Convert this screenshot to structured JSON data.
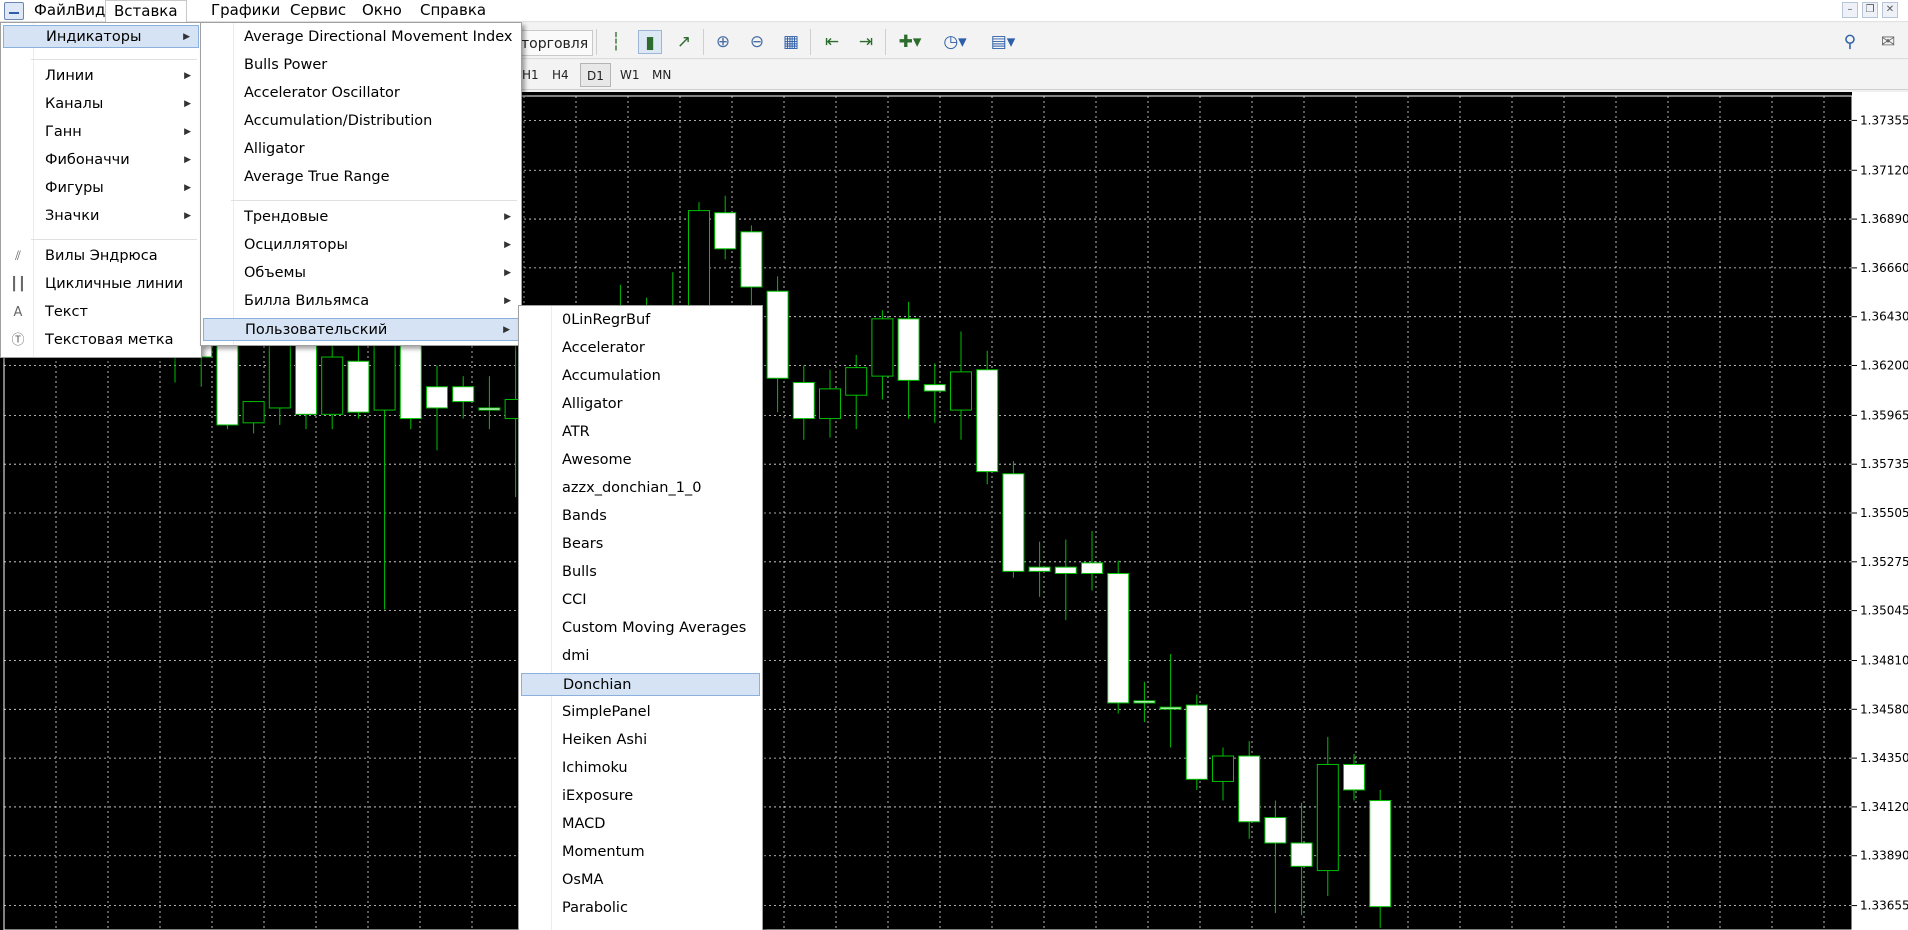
{
  "menubar": {
    "items": [
      "Файл",
      "Вид",
      "Вставка",
      "Графики",
      "Сервис",
      "Окно",
      "Справка"
    ],
    "active_index": 2
  },
  "window_controls": [
    "minimize-icon",
    "restore-icon",
    "close-icon"
  ],
  "toolbar": {
    "trade_label": "торговля",
    "icons": [
      "bar-chart-icon",
      "candlestick-icon",
      "line-chart-icon",
      "zoom-in-icon",
      "zoom-out-icon",
      "tile-windows-icon",
      "auto-scroll-icon",
      "chart-shift-icon",
      "indicators-icon",
      "periods-icon",
      "templates-icon",
      "search-icon",
      "chat-icon"
    ]
  },
  "timeframes": {
    "items": [
      "H1",
      "H4",
      "D1",
      "W1",
      "MN"
    ],
    "selected": "D1"
  },
  "insert_menu": {
    "items": [
      {
        "label": "Индикаторы",
        "submenu": true,
        "highlighted": true
      },
      {
        "separator": true
      },
      {
        "label": "Линии",
        "submenu": true
      },
      {
        "label": "Каналы",
        "submenu": true
      },
      {
        "label": "Ганн",
        "submenu": true
      },
      {
        "label": "Фибоначчи",
        "submenu": true
      },
      {
        "label": "Фигуры",
        "submenu": true
      },
      {
        "label": "Значки",
        "submenu": true
      },
      {
        "separator": true
      },
      {
        "label": "Вилы Эндрюса",
        "icon": "andrews-pitchfork-icon"
      },
      {
        "label": "Цикличные линии",
        "icon": "cycle-lines-icon"
      },
      {
        "label": "Текст",
        "icon": "text-icon"
      },
      {
        "label": "Текстовая метка",
        "icon": "text-label-icon"
      }
    ]
  },
  "indicators_menu": {
    "items": [
      {
        "label": "Average Directional Movement Index"
      },
      {
        "label": "Bulls Power"
      },
      {
        "label": "Accelerator Oscillator"
      },
      {
        "label": "Accumulation/Distribution"
      },
      {
        "label": "Alligator"
      },
      {
        "label": "Average True Range"
      },
      {
        "separator": true
      },
      {
        "label": "Трендовые",
        "submenu": true
      },
      {
        "label": "Осцилляторы",
        "submenu": true
      },
      {
        "label": "Объемы",
        "submenu": true
      },
      {
        "label": "Билла Вильямса",
        "submenu": true
      },
      {
        "label": "Пользовательский",
        "submenu": true,
        "highlighted": true
      }
    ]
  },
  "custom_menu": {
    "items": [
      {
        "label": "0LinRegrBuf"
      },
      {
        "label": "Accelerator"
      },
      {
        "label": "Accumulation"
      },
      {
        "label": "Alligator"
      },
      {
        "label": "ATR"
      },
      {
        "label": "Awesome"
      },
      {
        "label": "azzx_donchian_1_0"
      },
      {
        "label": "Bands"
      },
      {
        "label": "Bears"
      },
      {
        "label": "Bulls"
      },
      {
        "label": "CCI"
      },
      {
        "label": "Custom Moving Averages"
      },
      {
        "label": "dmi"
      },
      {
        "label": "Donchian",
        "highlighted": true
      },
      {
        "label": "SimplePanel"
      },
      {
        "label": "Heiken Ashi"
      },
      {
        "label": "Ichimoku"
      },
      {
        "label": "iExposure"
      },
      {
        "label": "MACD"
      },
      {
        "label": "Momentum"
      },
      {
        "label": "OsMA"
      },
      {
        "label": "Parabolic"
      }
    ]
  },
  "chart_data": {
    "type": "candlestick",
    "price_axis": [
      "1.37355",
      "1.37120",
      "1.36890",
      "1.36660",
      "1.36430",
      "1.36200",
      "1.35965",
      "1.35735",
      "1.35505",
      "1.35275",
      "1.35045",
      "1.34810",
      "1.34580",
      "1.34350",
      "1.34120",
      "1.33890",
      "1.33655"
    ],
    "ylim": [
      1.3354,
      1.3747
    ],
    "colors": {
      "background": "#000000",
      "grid": "#ffffff",
      "bull_body": "#000000",
      "bear_body": "#ffffff",
      "wick": "#00c000",
      "axis_text": "#000000",
      "axis_bg": "#ffffff"
    },
    "candles": [
      {
        "o": 1.3635,
        "h": 1.3655,
        "l": 1.3612,
        "c": 1.3625
      },
      {
        "o": 1.364,
        "h": 1.365,
        "l": 1.361,
        "c": 1.3624
      },
      {
        "o": 1.363,
        "h": 1.364,
        "l": 1.359,
        "c": 1.3592
      },
      {
        "o": 1.3593,
        "h": 1.36,
        "l": 1.3588,
        "c": 1.3603
      },
      {
        "o": 1.36,
        "h": 1.364,
        "l": 1.3592,
        "c": 1.3631
      },
      {
        "o": 1.363,
        "h": 1.364,
        "l": 1.359,
        "c": 1.3597
      },
      {
        "o": 1.3597,
        "h": 1.363,
        "l": 1.359,
        "c": 1.3624
      },
      {
        "o": 1.3622,
        "h": 1.363,
        "l": 1.3595,
        "c": 1.3598
      },
      {
        "o": 1.3599,
        "h": 1.363,
        "l": 1.3505,
        "c": 1.363
      },
      {
        "o": 1.363,
        "h": 1.364,
        "l": 1.359,
        "c": 1.3595
      },
      {
        "o": 1.361,
        "h": 1.362,
        "l": 1.358,
        "c": 1.36
      },
      {
        "o": 1.361,
        "h": 1.3615,
        "l": 1.3595,
        "c": 1.3603
      },
      {
        "o": 1.36,
        "h": 1.3615,
        "l": 1.359,
        "c": 1.3599
      },
      {
        "o": 1.3595,
        "h": 1.363,
        "l": 1.3558,
        "c": 1.3604
      },
      {
        "o": 1.3603,
        "h": 1.3613,
        "l": 1.3568,
        "c": 1.36
      },
      {
        "o": 1.3605,
        "h": 1.362,
        "l": 1.3589,
        "c": 1.3608
      },
      {
        "o": 1.3607,
        "h": 1.3612,
        "l": 1.359,
        "c": 1.3609
      },
      {
        "o": 1.3608,
        "h": 1.3658,
        "l": 1.3574,
        "c": 1.3628
      },
      {
        "o": 1.3628,
        "h": 1.3652,
        "l": 1.3578,
        "c": 1.3614
      },
      {
        "o": 1.3614,
        "h": 1.3664,
        "l": 1.3609,
        "c": 1.3647
      },
      {
        "o": 1.3643,
        "h": 1.3697,
        "l": 1.3638,
        "c": 1.3693
      },
      {
        "o": 1.3692,
        "h": 1.37,
        "l": 1.367,
        "c": 1.3675
      },
      {
        "o": 1.3683,
        "h": 1.3686,
        "l": 1.364,
        "c": 1.3657
      },
      {
        "o": 1.3655,
        "h": 1.3662,
        "l": 1.3598,
        "c": 1.3614
      },
      {
        "o": 1.3612,
        "h": 1.362,
        "l": 1.3585,
        "c": 1.3595
      },
      {
        "o": 1.3595,
        "h": 1.3618,
        "l": 1.3586,
        "c": 1.3609
      },
      {
        "o": 1.3606,
        "h": 1.3625,
        "l": 1.359,
        "c": 1.3619
      },
      {
        "o": 1.3615,
        "h": 1.3646,
        "l": 1.3604,
        "c": 1.3642
      },
      {
        "o": 1.3642,
        "h": 1.365,
        "l": 1.3595,
        "c": 1.3613
      },
      {
        "o": 1.3611,
        "h": 1.3621,
        "l": 1.3593,
        "c": 1.3608
      },
      {
        "o": 1.3599,
        "h": 1.3636,
        "l": 1.3585,
        "c": 1.3617
      },
      {
        "o": 1.3618,
        "h": 1.3627,
        "l": 1.3564,
        "c": 1.357
      },
      {
        "o": 1.3569,
        "h": 1.3575,
        "l": 1.352,
        "c": 1.3523
      },
      {
        "o": 1.3525,
        "h": 1.3537,
        "l": 1.3511,
        "c": 1.3523
      },
      {
        "o": 1.3525,
        "h": 1.3538,
        "l": 1.35,
        "c": 1.3522
      },
      {
        "o": 1.3527,
        "h": 1.3542,
        "l": 1.3514,
        "c": 1.3522
      },
      {
        "o": 1.3522,
        "h": 1.3528,
        "l": 1.3456,
        "c": 1.3461
      },
      {
        "o": 1.3462,
        "h": 1.3471,
        "l": 1.3452,
        "c": 1.3461
      },
      {
        "o": 1.3459,
        "h": 1.3484,
        "l": 1.344,
        "c": 1.3459
      },
      {
        "o": 1.346,
        "h": 1.3465,
        "l": 1.342,
        "c": 1.3425
      },
      {
        "o": 1.3424,
        "h": 1.344,
        "l": 1.3415,
        "c": 1.3436
      },
      {
        "o": 1.3436,
        "h": 1.3443,
        "l": 1.3397,
        "c": 1.3405
      },
      {
        "o": 1.3407,
        "h": 1.3415,
        "l": 1.3362,
        "c": 1.3395
      },
      {
        "o": 1.3395,
        "h": 1.3414,
        "l": 1.3361,
        "c": 1.3384
      },
      {
        "o": 1.3382,
        "h": 1.3445,
        "l": 1.337,
        "c": 1.3432
      },
      {
        "o": 1.3432,
        "h": 1.3437,
        "l": 1.3415,
        "c": 1.342
      },
      {
        "o": 1.3415,
        "h": 1.342,
        "l": 1.3355,
        "c": 1.3365
      }
    ]
  }
}
